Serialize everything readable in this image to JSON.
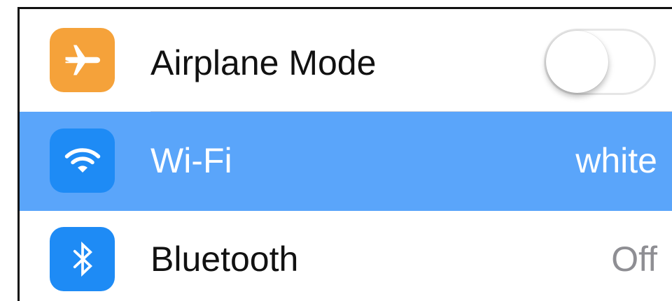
{
  "settings": {
    "items": [
      {
        "label": "Airplane Mode",
        "icon": "airplane-icon",
        "icon_color": "#F5A23A",
        "control": "toggle",
        "toggle_on": false
      },
      {
        "label": "Wi-Fi",
        "value": "white",
        "icon": "wifi-icon",
        "icon_color": "#1E8BF5",
        "selected": true,
        "highlight_color": "#5AA5FA"
      },
      {
        "label": "Bluetooth",
        "value": "Off",
        "icon": "bluetooth-icon",
        "icon_color": "#1E8BF5"
      }
    ]
  }
}
